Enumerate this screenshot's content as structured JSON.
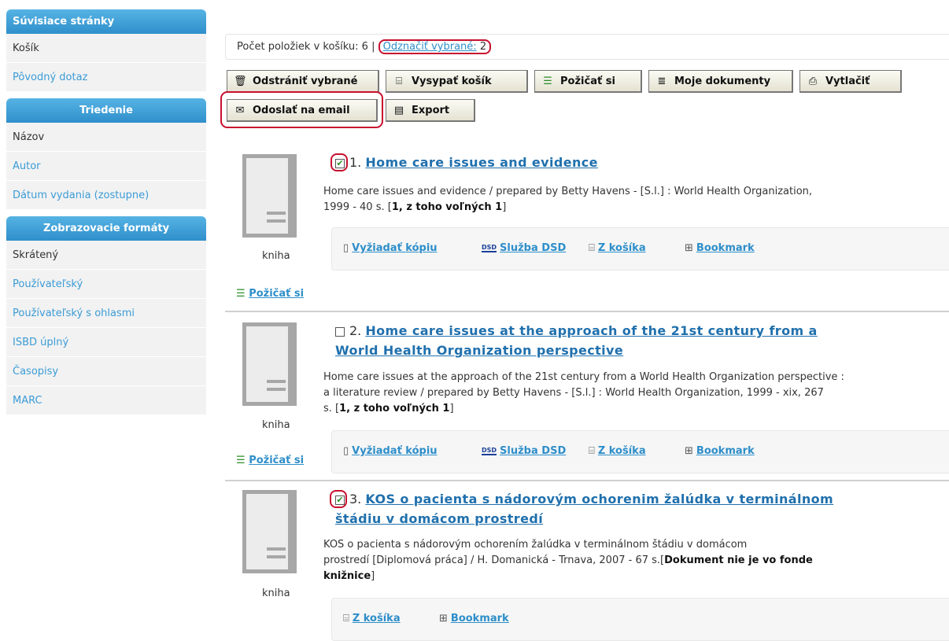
{
  "sidebar": {
    "related_heading": "Súvisiace stránky",
    "related_items": [
      "Košík",
      "Pôvodný dotaz"
    ],
    "sort_heading": "Triedenie",
    "sort_items": [
      "Názov",
      "Autor",
      "Dátum vydania (zostupne)"
    ],
    "formats_heading": "Zobrazovacie formáty",
    "format_items": [
      "Skrátený",
      "Používateľský",
      "Používateľský s ohlasmi",
      "ISBD úplný",
      "Časopisy",
      "MARC"
    ]
  },
  "cart": {
    "count_text": "Počet položiek v košíku: 6 |",
    "deselect_label": "Odznačiť vybrané:",
    "selected_count": "2"
  },
  "toolbar": {
    "remove_selected": "Odstrániť vybrané",
    "empty_cart": "Vysypať košík",
    "borrow": "Požičať si",
    "my_documents": "Moje dokumenty",
    "print": "Vytlačiť",
    "send_email": "Odoslať na email",
    "export": "Export"
  },
  "records": [
    {
      "number": "1.",
      "title_line1": "Home care issues and evidence",
      "title_line2": "",
      "checked": true,
      "desc_line1": "Home care issues and evidence / prepared by Betty Havens - [S.l.] : World Health Organization,",
      "desc_line2_plain": "1999 - 40 s. [",
      "desc_line2_bold": "1, z toho voľných 1",
      "desc_line2_end": "]",
      "format": "kniha",
      "actions": [
        "Vyžiadať kópiu",
        "Služba DSD",
        "Z košíka",
        "Bookmark"
      ],
      "borrow": "Požičať si"
    },
    {
      "number": "2.",
      "title_line1": "Home care issues at the approach of the 21st century from a",
      "title_line2": "World Health Organization perspective",
      "checked": false,
      "desc_line1": "Home care issues at the approach of the 21st century from a World Health Organization perspective :",
      "desc_line2": "a literature review / prepared by Betty Havens - [S.l.] : World Health Organization, 1999 - xix, 267",
      "desc_line3_plain": "s. [",
      "desc_line3_bold": "1, z toho voľných 1",
      "desc_line3_end": "]",
      "format": "kniha",
      "actions": [
        "Vyžiadať kópiu",
        "Služba DSD",
        "Z košíka",
        "Bookmark"
      ],
      "borrow": "Požičať si"
    },
    {
      "number": "3.",
      "title_line1": "KOS o pacienta s nádorovým ochorenim žalúdka v terminálnom",
      "title_line2": "štádiu v domácom prostredí",
      "checked": true,
      "desc_line1": "KOS o pacienta s nádorovým ochorením žalúdka v terminálnom štádiu v domácom",
      "desc_line2_plain": "prostredí [Diplomová práca] / H. Domanická - Trnava, 2007 - 67 s.[",
      "desc_line2_bold": "Dokument nie je vo fonde",
      "desc_line3_bold": "knižnice",
      "desc_line3_end": "]",
      "format": "kniha",
      "actions": [
        "Z košíka",
        "Bookmark"
      ]
    }
  ]
}
